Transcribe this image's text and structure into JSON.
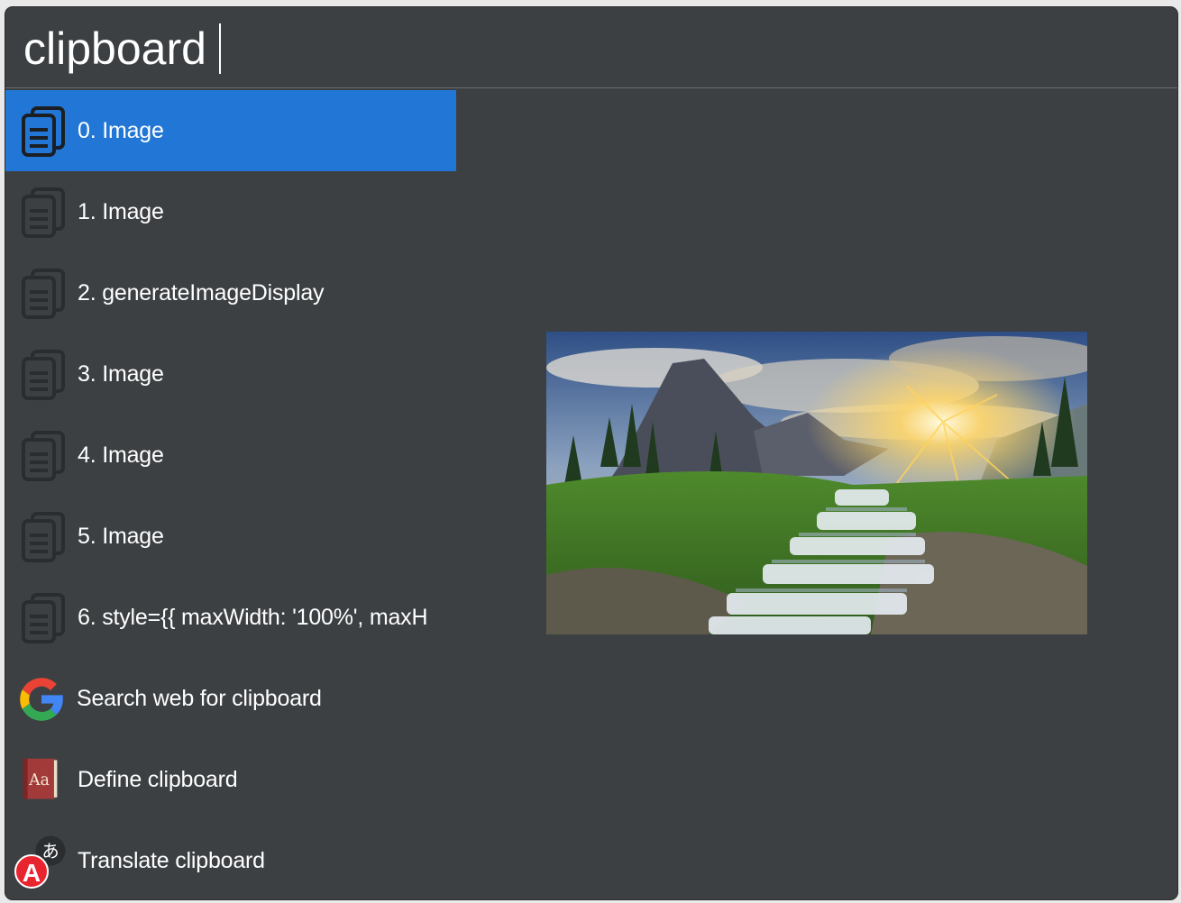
{
  "search": {
    "query": "clipboard"
  },
  "results": [
    {
      "label": "0. Image",
      "icon": "clipboard-doc-icon",
      "selected": true
    },
    {
      "label": "1. Image",
      "icon": "clipboard-doc-icon"
    },
    {
      "label": "2. generateImageDisplay",
      "icon": "clipboard-doc-icon"
    },
    {
      "label": "3. Image",
      "icon": "clipboard-doc-icon"
    },
    {
      "label": "4. Image",
      "icon": "clipboard-doc-icon"
    },
    {
      "label": "5. Image",
      "icon": "clipboard-doc-icon"
    },
    {
      "label": "6. style={{ maxWidth: '100%', maxH",
      "icon": "clipboard-doc-icon"
    },
    {
      "label": "Search web for clipboard",
      "icon": "google-icon"
    },
    {
      "label": "Define clipboard",
      "icon": "dictionary-icon"
    },
    {
      "label": "Translate clipboard",
      "icon": "translate-icon"
    }
  ],
  "preview": {
    "subject": "landscape-photo",
    "badge_letter": "A"
  },
  "colors": {
    "background": "#3c4043",
    "selection": "#2277d6",
    "text": "#ffffff"
  }
}
